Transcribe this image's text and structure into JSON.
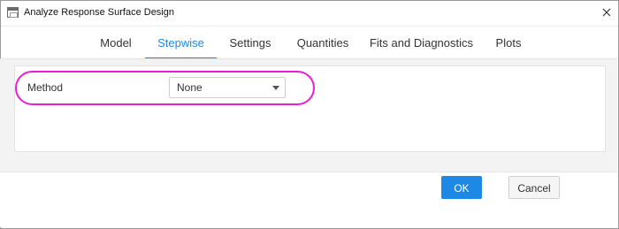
{
  "window": {
    "title": "Analyze Response Surface Design"
  },
  "tabs": [
    {
      "label": "Model",
      "active": false
    },
    {
      "label": "Stepwise",
      "active": true
    },
    {
      "label": "Settings",
      "active": false
    },
    {
      "label": "Quantities",
      "active": false
    },
    {
      "label": "Fits and Diagnostics",
      "active": false
    },
    {
      "label": "Plots",
      "active": false
    }
  ],
  "stepwise": {
    "method_label": "Method",
    "method_value": "None"
  },
  "footer": {
    "ok_label": "OK",
    "cancel_label": "Cancel"
  },
  "colors": {
    "accent": "#1e88e5",
    "highlight": "#e51fd8"
  },
  "icons": {
    "app": "window-app-icon",
    "close": "close-icon",
    "dropdown": "chevron-down-icon"
  }
}
